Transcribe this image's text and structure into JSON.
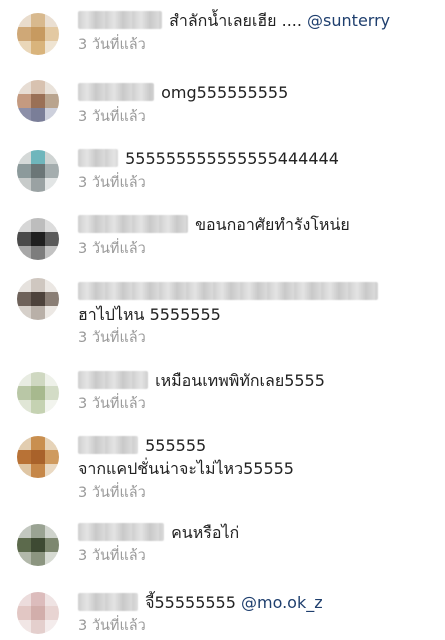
{
  "comments": [
    {
      "text": "สำลักน้ำเลยเฮีย ....",
      "mention": "@sunterry",
      "time": "3 วันที่แล้ว"
    },
    {
      "text": "omg555555555",
      "time": "3 วันที่แล้ว"
    },
    {
      "text": "555555555555555444444",
      "time": "3 วันที่แล้ว"
    },
    {
      "text": "ขอนกอาศัยทำรังโหน่ย",
      "time": "3 วันที่แล้ว"
    },
    {
      "text": "ฮาไปไหน 5555555",
      "time": "3 วันที่แล้ว"
    },
    {
      "text": "เหมือนเทพพิทักเลย5555",
      "time": "3 วันที่แล้ว"
    },
    {
      "text": "555555",
      "text2": "จากแคปชั่นน่าจะไม่ไหว55555",
      "time": "3 วันที่แล้ว"
    },
    {
      "text": "คนหรือไก่",
      "time": "3 วันที่แล้ว"
    },
    {
      "text": "จี้55555555",
      "mention": "@mo.ok_z",
      "time": "3 วันที่แล้ว"
    }
  ]
}
